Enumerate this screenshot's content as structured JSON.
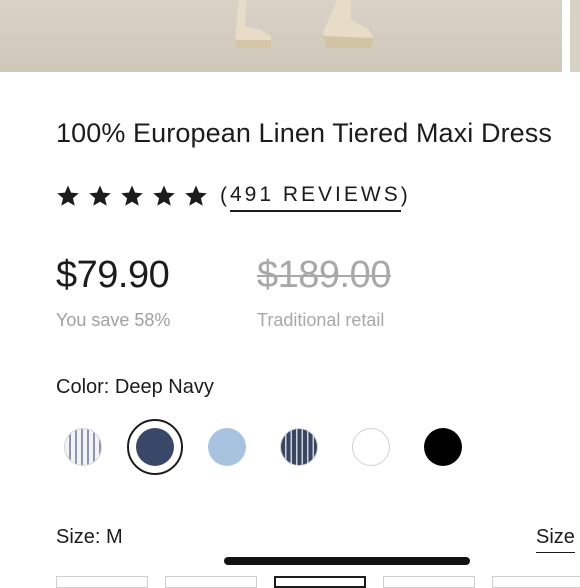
{
  "product": {
    "title": "100% European Linen Tiered Maxi Dress",
    "rating": 5,
    "reviews_prefix": "(",
    "reviews_label": "491 REVIEWS",
    "reviews_suffix": ")"
  },
  "pricing": {
    "price": "$79.90",
    "savings": "You save 58%",
    "retail_price": "$189.00",
    "retail_label": "Traditional retail"
  },
  "color": {
    "label": "Color: Deep Navy",
    "swatches": [
      {
        "name": "blue-white-stripe",
        "color": "#8b95ac"
      },
      {
        "name": "deep-navy",
        "color": "#394768",
        "selected": true
      },
      {
        "name": "light-blue",
        "color": "#a8c3e0"
      },
      {
        "name": "navy-pinstripe",
        "color": "#3a4560"
      },
      {
        "name": "white",
        "color": "#ffffff"
      },
      {
        "name": "black",
        "color": "#000000"
      }
    ]
  },
  "size": {
    "label": "Size: M",
    "guide_label": "Size"
  },
  "colors": {
    "text": "#1c1c1c",
    "muted": "#a0a0a0"
  }
}
